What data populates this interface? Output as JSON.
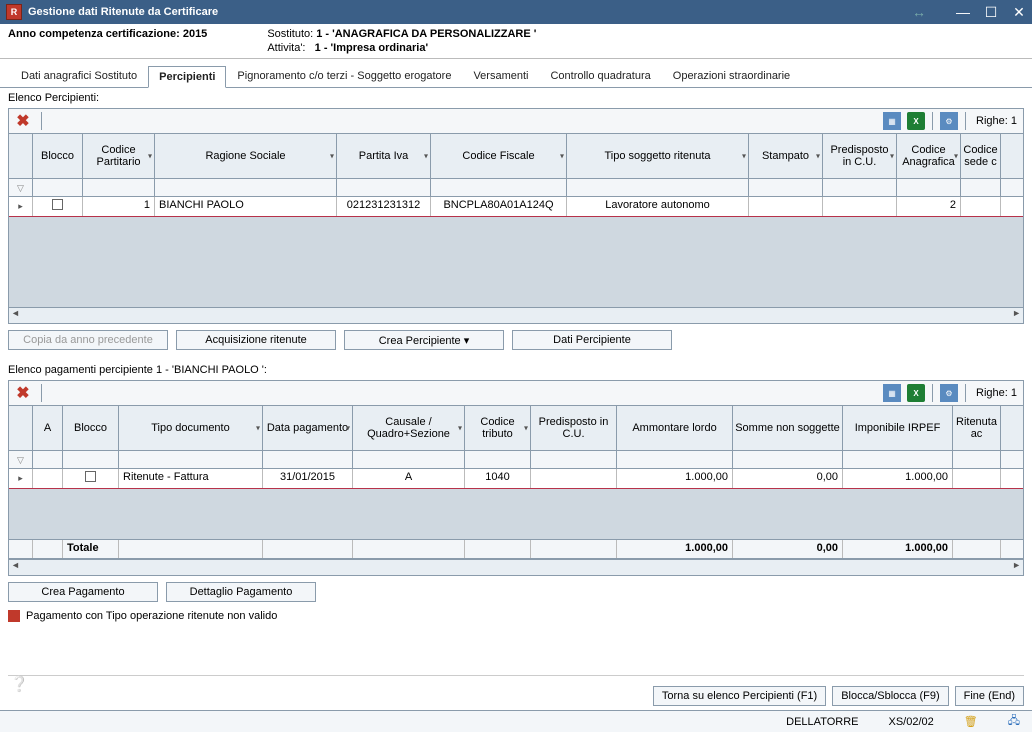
{
  "window": {
    "title": "Gestione dati Ritenute da Certificare"
  },
  "info": {
    "anno_label": "Anno competenza certificazione:",
    "anno": "2015",
    "sostituto_label": "Sostituto:",
    "sostituto": "1 - 'ANAGRAFICA DA PERSONALIZZARE '",
    "attivita_label": "Attivita':",
    "attivita": "1 - 'Impresa ordinaria'"
  },
  "tabs": [
    "Dati anagrafici Sostituto",
    "Percipienti",
    "Pignoramento c/o terzi - Soggetto erogatore",
    "Versamenti",
    "Controllo quadratura",
    "Operazioni straordinarie"
  ],
  "grid1": {
    "label": "Elenco Percipienti:",
    "righe_label": "Righe: 1",
    "cols": [
      "",
      "Blocco",
      "Codice Partitario",
      "Ragione Sociale",
      "Partita Iva",
      "Codice Fiscale",
      "Tipo soggetto ritenuta",
      "Stampato",
      "Predisposto in C.U.",
      "Codice Anagrafica",
      "Codice sede c"
    ],
    "row": {
      "partitario": "1",
      "ragione": "BIANCHI PAOLO",
      "piva": "021231231312",
      "cf": "BNCPLA80A01A124Q",
      "tipo": "Lavoratore autonomo",
      "anag": "2"
    },
    "buttons": {
      "copia": "Copia da anno precedente",
      "acq": "Acquisizione ritenute",
      "crea": "Crea Percipiente ▾",
      "dati": "Dati Percipiente"
    }
  },
  "grid2": {
    "label": "Elenco pagamenti percipiente 1 - 'BIANCHI PAOLO ':",
    "righe_label": "Righe: 1",
    "cols": [
      "",
      "A",
      "Blocco",
      "Tipo documento",
      "Data pagamento",
      "Causale / Quadro+Sezione",
      "Codice tributo",
      "Predisposto in C.U.",
      "Ammontare lordo",
      "Somme non soggette",
      "Imponibile IRPEF",
      "Ritenuta ac"
    ],
    "row": {
      "tipo_doc": "Ritenute - Fattura",
      "data": "31/01/2015",
      "causale": "A",
      "tributo": "1040",
      "lordo": "1.000,00",
      "somme": "0,00",
      "irpef": "1.000,00"
    },
    "total_label": "Totale",
    "totals": {
      "lordo": "1.000,00",
      "somme": "0,00",
      "irpef": "1.000,00"
    },
    "buttons": {
      "crea": "Crea Pagamento",
      "dett": "Dettaglio Pagamento"
    }
  },
  "legend_text": "Pagamento con Tipo operazione ritenute non valido",
  "footer": {
    "torna": "Torna su elenco Percipienti (F1)",
    "blocca": "Blocca/Sblocca (F9)",
    "fine": "Fine (End)"
  },
  "status": {
    "user": "DELLATORRE",
    "code": "XS/02/02"
  }
}
